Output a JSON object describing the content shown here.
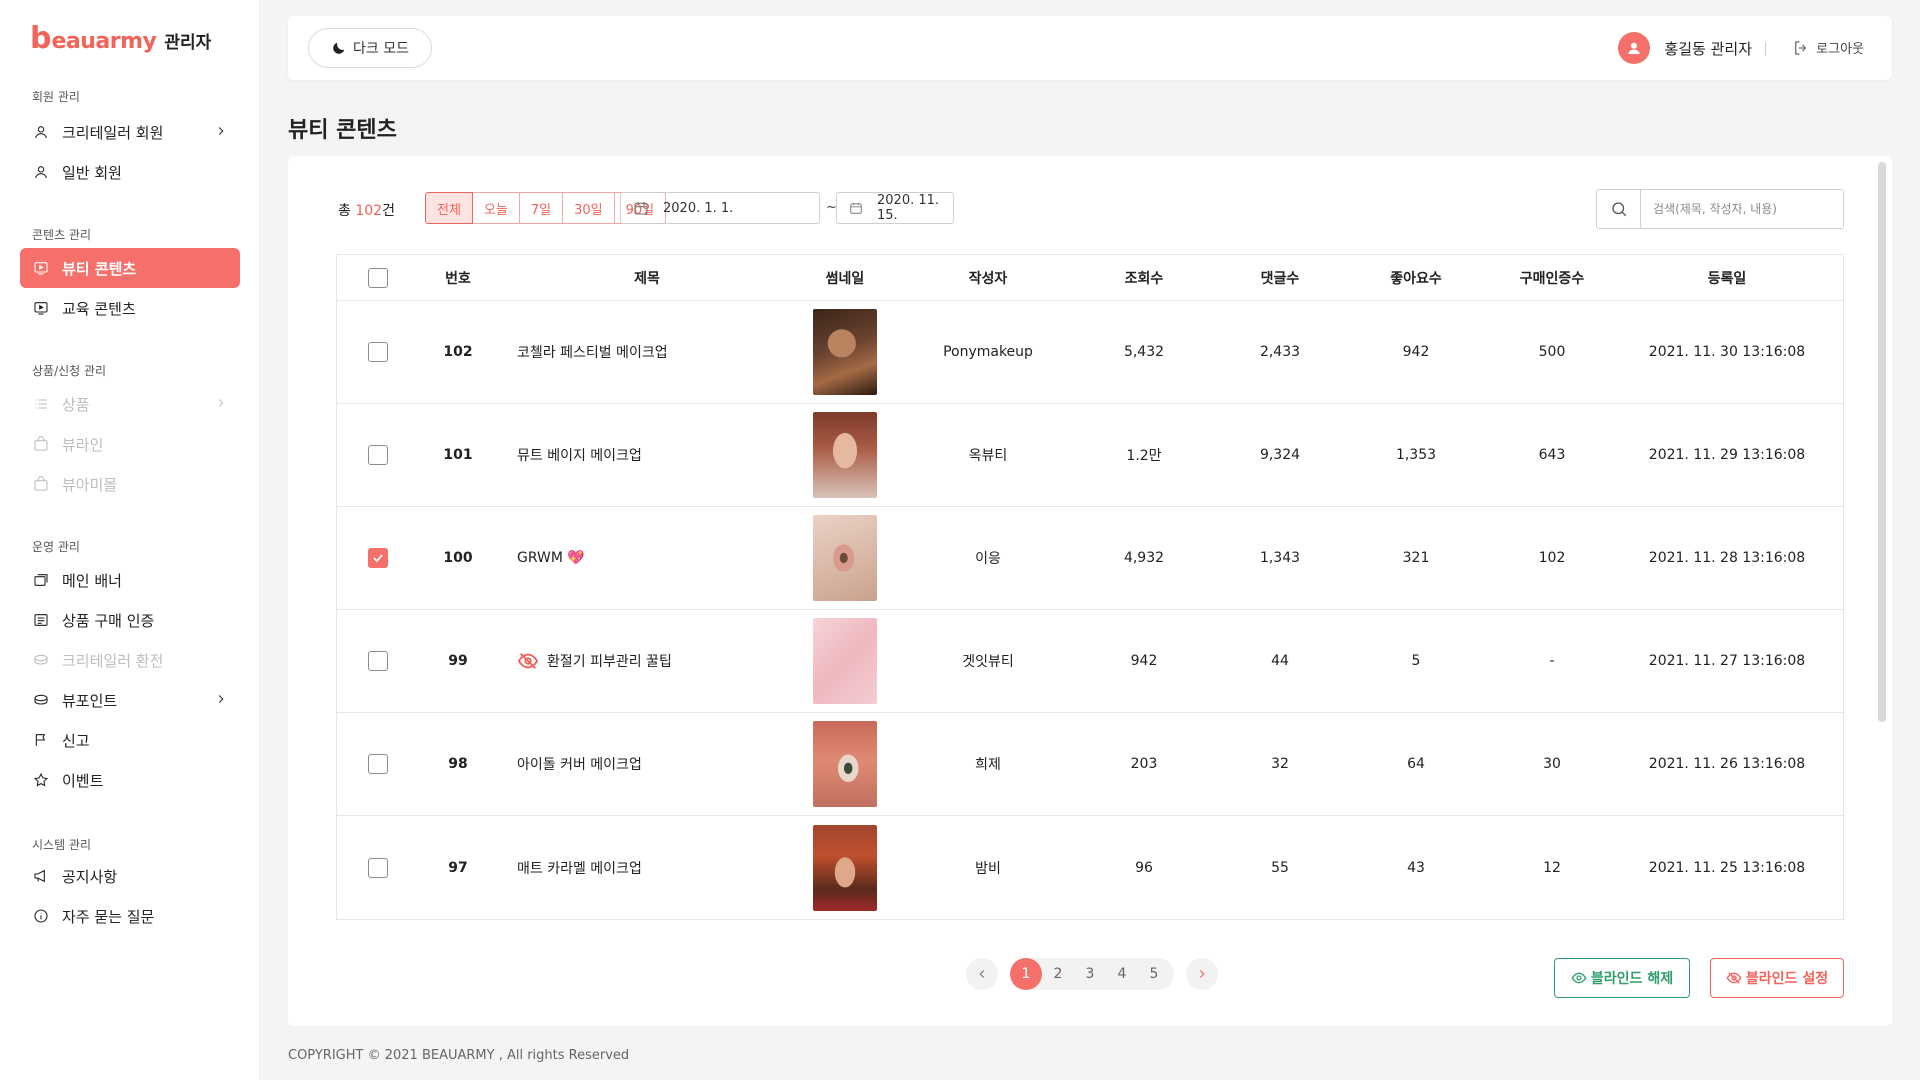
{
  "brand": {
    "logo_b": "b",
    "logo_text": "eauarmy",
    "admin": "관리자",
    "accent": "#f5706a"
  },
  "sidebar": {
    "sections": [
      {
        "title": "회원 관리"
      },
      {
        "title": "콘텐츠 관리"
      },
      {
        "title": "상품/신청 관리"
      },
      {
        "title": "운영 관리"
      },
      {
        "title": "시스템 관리"
      }
    ],
    "items": [
      {
        "label": "크리테일러 회원",
        "icon": "user-icon",
        "chevron": true
      },
      {
        "label": "일반 회원",
        "icon": "user-icon"
      },
      {
        "label": "뷰티 콘텐츠",
        "icon": "video-icon",
        "active": true
      },
      {
        "label": "교육 콘텐츠",
        "icon": "video-icon"
      },
      {
        "label": "상품",
        "icon": "list-icon",
        "chevron": true,
        "disabled": true
      },
      {
        "label": "뷰라인",
        "icon": "bag-icon",
        "disabled": true
      },
      {
        "label": "뷰아미몰",
        "icon": "bag-icon",
        "disabled": true
      },
      {
        "label": "메인 배너",
        "icon": "banner-icon"
      },
      {
        "label": "상품 구매 인증",
        "icon": "receipt-icon"
      },
      {
        "label": "크리테일러 환전",
        "icon": "coins-icon",
        "disabled": true
      },
      {
        "label": "뷰포인트",
        "icon": "coins-icon",
        "chevron": true
      },
      {
        "label": "신고",
        "icon": "flag-icon"
      },
      {
        "label": "이벤트",
        "icon": "star-icon"
      },
      {
        "label": "공지사항",
        "icon": "megaphone-icon"
      },
      {
        "label": "자주 묻는 질문",
        "icon": "info-icon"
      }
    ]
  },
  "topbar": {
    "dark_mode": "다크 모드",
    "user_name": "홍길동 관리자",
    "logout": "로그아웃"
  },
  "page_title": "뷰티 콘텐츠",
  "filters": {
    "total_prefix": "총 ",
    "total_count": "102",
    "total_suffix": "건",
    "ranges": [
      "전체",
      "오늘",
      "7일",
      "30일",
      "90일"
    ],
    "active_range": "전체",
    "date_from": "2020. 1. 1.",
    "date_sep": "~",
    "date_to": "2020. 11. 15.",
    "search_placeholder": "검색(제목, 작성자, 내용)"
  },
  "table": {
    "headers": {
      "no": "번호",
      "title": "제목",
      "thumb": "썸네일",
      "author": "작성자",
      "views": "조회수",
      "comments": "댓글수",
      "likes": "좋아요수",
      "purchase": "구매인증수",
      "date": "등록일"
    },
    "rows": [
      {
        "no": "102",
        "title": "코첼라 페스티벌 메이크업",
        "author": "Ponymakeup",
        "views": "5,432",
        "comments": "2,433",
        "likes": "942",
        "purchase": "500",
        "date": "2021. 11. 30 13:16:08",
        "checked": false,
        "blinded": false,
        "emoji": ""
      },
      {
        "no": "101",
        "title": "뮤트 베이지 메이크업",
        "author": "옥뷰티",
        "views": "1.2만",
        "comments": "9,324",
        "likes": "1,353",
        "purchase": "643",
        "date": "2021. 11. 29 13:16:08",
        "checked": false,
        "blinded": false,
        "emoji": ""
      },
      {
        "no": "100",
        "title": "GRWM",
        "author": "이응",
        "views": "4,932",
        "comments": "1,343",
        "likes": "321",
        "purchase": "102",
        "date": "2021. 11. 28 13:16:08",
        "checked": true,
        "blinded": false,
        "emoji": "💖"
      },
      {
        "no": "99",
        "title": "환절기 피부관리 꿀팁",
        "author": "겟잇뷰티",
        "views": "942",
        "comments": "44",
        "likes": "5",
        "purchase": "-",
        "date": "2021. 11. 27 13:16:08",
        "checked": false,
        "blinded": true,
        "emoji": ""
      },
      {
        "no": "98",
        "title": "아이돌 커버 메이크업",
        "author": "희제",
        "views": "203",
        "comments": "32",
        "likes": "64",
        "purchase": "30",
        "date": "2021. 11. 26 13:16:08",
        "checked": false,
        "blinded": false,
        "emoji": ""
      },
      {
        "no": "97",
        "title": "매트 카라멜 메이크업",
        "author": "밤비",
        "views": "96",
        "comments": "55",
        "likes": "43",
        "purchase": "12",
        "date": "2021. 11. 25 13:16:08",
        "checked": false,
        "blinded": false,
        "emoji": ""
      }
    ]
  },
  "pagination": {
    "pages": [
      "1",
      "2",
      "3",
      "4",
      "5"
    ],
    "current": "1"
  },
  "actions": {
    "unblind": "블라인드 해제",
    "blind": "블라인드 설정"
  },
  "footer": "COPYRIGHT © 2021 BEAUARMY , All rights Reserved"
}
